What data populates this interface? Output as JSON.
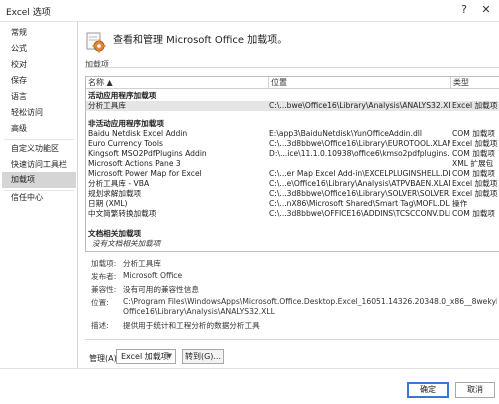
{
  "window": {
    "title": "Excel 选项",
    "help_glyph": "?",
    "close_glyph": "✕"
  },
  "sidebar": {
    "items": [
      {
        "label": "常规"
      },
      {
        "label": "公式"
      },
      {
        "label": "校对"
      },
      {
        "label": "保存"
      },
      {
        "label": "语言"
      },
      {
        "label": "轻松访问"
      },
      {
        "label": "高级"
      },
      {
        "label": "自定义功能区"
      },
      {
        "label": "快速访问工具栏"
      },
      {
        "label": "加载项"
      },
      {
        "label": "信任中心"
      }
    ],
    "active_index": 9
  },
  "header": {
    "text": "查看和管理 Microsoft Office 加载项。"
  },
  "addins_section": {
    "title": "加载项"
  },
  "table": {
    "columns": {
      "name": "名称 ▲",
      "location": "位置",
      "type": "类型"
    },
    "groups": {
      "active": "活动应用程序加载项",
      "inactive": "非活动应用程序加载项",
      "document": "文档相关加载项",
      "document_note": "没有文档相关加载项"
    },
    "active_rows": [
      {
        "name": "分析工具库",
        "location": "C:\\...bwe\\Office16\\Library\\Analysis\\ANALYS32.XLL",
        "type": "Excel 加载项"
      }
    ],
    "inactive_rows": [
      {
        "name": "Baidu Netdisk Excel Addin",
        "location": "E:\\app3\\BaiduNetdisk\\YunOfficeAddin.dll",
        "type": "COM 加载项"
      },
      {
        "name": "Euro Currency Tools",
        "location": "C:\\...3d8bbwe\\Office16\\Library\\EUROTOOL.XLAM",
        "type": "Excel 加载项"
      },
      {
        "name": "Kingsoft MSO2PdfPlugins Addin",
        "location": "D:\\...ice\\11.1.0.10938\\office6\\kmso2pdfplugins.dll",
        "type": "COM 加载项"
      },
      {
        "name": "Microsoft Actions Pane 3",
        "location": "",
        "type": "XML 扩展包"
      },
      {
        "name": "Microsoft Power Map for Excel",
        "location": "C:\\...er Map Excel Add-in\\EXCELPLUGINSHELL.DLL",
        "type": "COM 加载项"
      },
      {
        "name": "分析工具库 - VBA",
        "location": "C:\\...e\\Office16\\Library\\Analysis\\ATPVBAEN.XLAM",
        "type": "Excel 加载项"
      },
      {
        "name": "规划求解加载项",
        "location": "C:\\...3d8bbwe\\Office16\\Library\\SOLVER\\SOLVER.XLAM",
        "type": "Excel 加载项"
      },
      {
        "name": "日期 (XML)",
        "location": "C:\\...nX86\\Microsoft Shared\\Smart Tag\\MOFL.DLL",
        "type": "操作"
      },
      {
        "name": "中文简繁转换加载项",
        "location": "C:\\...3d8bbwe\\OFFICE16\\ADDINS\\TCSCCONV.DLL",
        "type": "COM 加载项"
      }
    ]
  },
  "details": {
    "addin_label": "加载项:",
    "addin_value": "分析工具库",
    "publisher_label": "发布者:",
    "publisher_value": "Microsoft Office",
    "compat_label": "兼容性:",
    "compat_value": "没有可用的兼容性信息",
    "location_label": "位置:",
    "location_value_1": "C:\\Program Files\\WindowsApps\\Microsoft.Office.Desktop.Excel_16051.14326.20348.0_x86__8wekyb3d8bbwe\\",
    "location_value_2": "Office16\\Library\\Analysis\\ANALYS32.XLL",
    "desc_label": "描述:",
    "desc_value": "提供用于统计和工程分析的数据分析工具"
  },
  "manage": {
    "label": "管理(A):",
    "selected": "Excel 加载项",
    "goto_label": "转到(G)..."
  },
  "footer": {
    "ok_label": "确定",
    "cancel_label": "取消"
  },
  "colors": {
    "accent": "#3a78d6",
    "selected_row": "#e5e5e5",
    "active_nav": "#d5d5d5"
  }
}
